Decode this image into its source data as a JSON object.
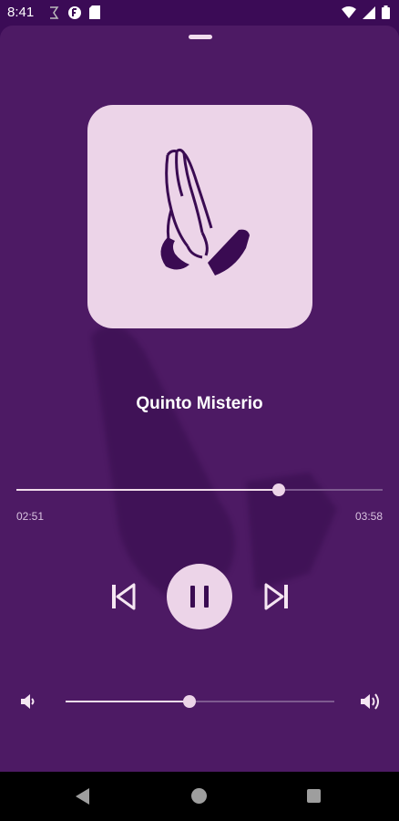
{
  "status_bar": {
    "time": "8:41",
    "left_icons": [
      "notification-icon",
      "app-icon",
      "sd-card-icon"
    ],
    "right_icons": [
      "wifi-icon",
      "signal-icon",
      "battery-icon"
    ]
  },
  "player": {
    "title": "Quinto Misterio",
    "elapsed": "02:51",
    "total": "03:58",
    "progress_fraction": 0.716,
    "volume_fraction": 0.46,
    "is_playing": true,
    "artwork_icon": "praying-hands-icon"
  },
  "controls": {
    "previous_icon": "skip-previous-icon",
    "play_pause_icon": "pause-icon",
    "next_icon": "skip-next-icon",
    "volume_low_icon": "volume-low-icon",
    "volume_high_icon": "volume-high-icon"
  },
  "nav_bar": {
    "icons": [
      "back-icon",
      "home-icon",
      "recents-icon"
    ]
  },
  "colors": {
    "background": "#3b0b56",
    "sheet": "#4d1a64",
    "accent": "#ecd4e8"
  }
}
